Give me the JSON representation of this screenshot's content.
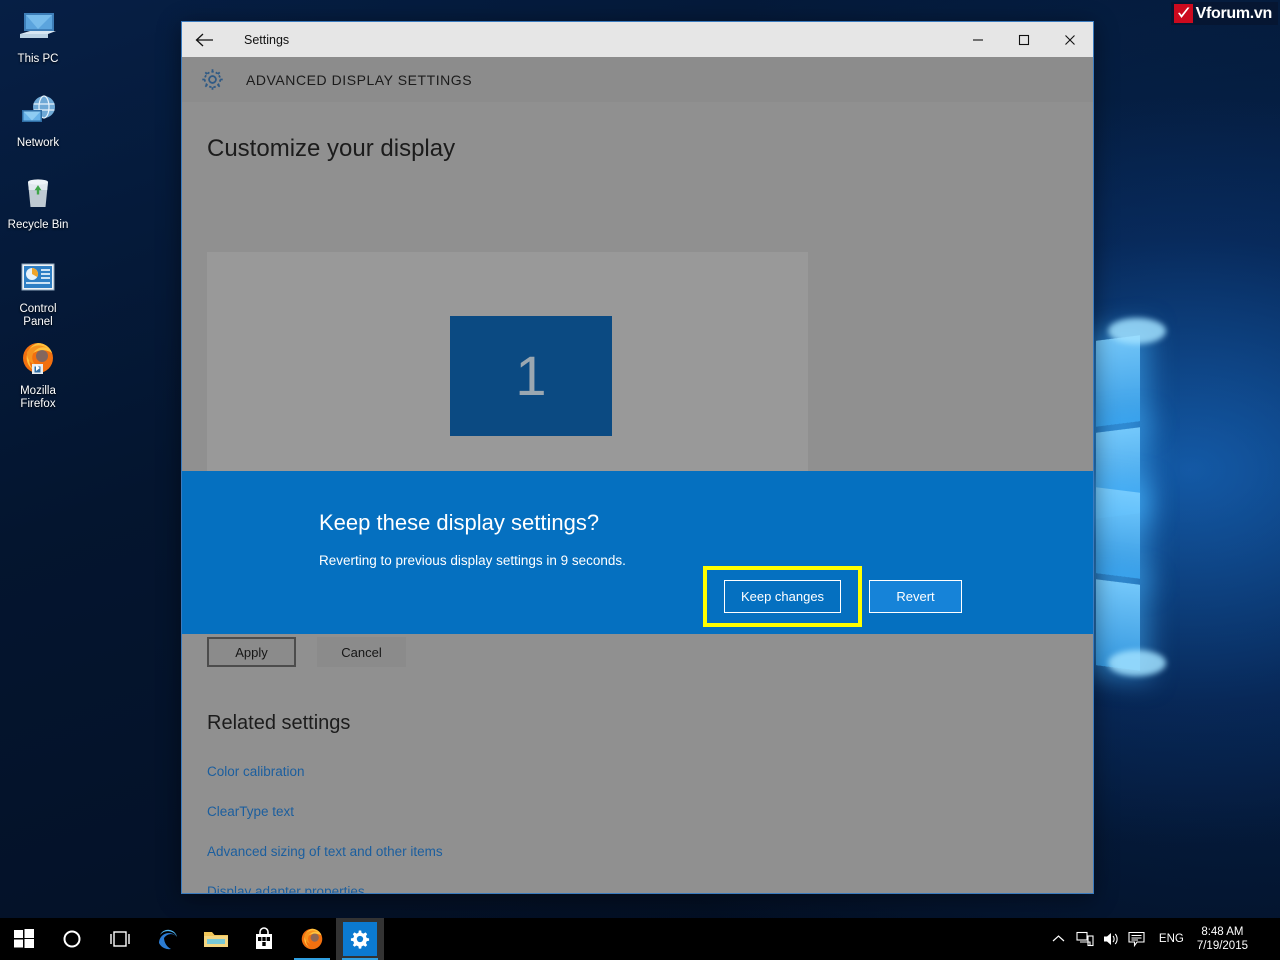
{
  "desktop": {
    "icons": [
      {
        "label": "This PC",
        "icon": "this-pc-icon"
      },
      {
        "label": "Network",
        "icon": "network-icon"
      },
      {
        "label": "Recycle Bin",
        "icon": "recycle-bin-icon"
      },
      {
        "label": "Control\nPanel",
        "label_line1": "Control",
        "label_line2": "Panel",
        "icon": "control-panel-icon"
      },
      {
        "label": "Mozilla\nFirefox",
        "label_line1": "Mozilla",
        "label_line2": "Firefox",
        "icon": "firefox-icon"
      }
    ]
  },
  "window": {
    "title": "Settings",
    "back_icon": "back-arrow-icon",
    "minimize_label": "─",
    "maximize_label": "□",
    "close_label": "✕",
    "app_header": {
      "icon": "gear-icon",
      "title": "ADVANCED DISPLAY SETTINGS"
    }
  },
  "main": {
    "page_heading": "Customize your display",
    "monitor_number": "1",
    "apply_label": "Apply",
    "cancel_label": "Cancel",
    "related_heading": "Related settings",
    "related_links": [
      "Color calibration",
      "ClearType text",
      "Advanced sizing of text and other items",
      "Display adapter properties"
    ]
  },
  "keep_dialog": {
    "title": "Keep these display settings?",
    "subtitle": "Reverting to previous display settings in  9 seconds.",
    "seconds_remaining": "9",
    "keep_label": "Keep changes",
    "revert_label": "Revert",
    "highlight_color": "#ffff00",
    "banner_color": "#0570c0"
  },
  "taskbar": {
    "items": [
      {
        "name": "start-button",
        "icon": "windows-logo-icon"
      },
      {
        "name": "cortana-search",
        "icon": "circle-icon"
      },
      {
        "name": "task-view",
        "icon": "task-view-icon"
      },
      {
        "name": "edge-browser",
        "icon": "edge-icon"
      },
      {
        "name": "file-explorer",
        "icon": "folder-icon"
      },
      {
        "name": "microsoft-store",
        "icon": "store-bag-icon"
      },
      {
        "name": "firefox",
        "icon": "firefox-icon"
      },
      {
        "name": "settings-app",
        "icon": "gear-icon"
      }
    ],
    "tray": {
      "show_hidden_icon": "chevron-up-icon",
      "network_icon": "network-icon",
      "volume_icon": "speaker-icon",
      "action_center_icon": "action-center-icon",
      "language": "ENG",
      "time": "8:48 AM",
      "date": "7/19/2015"
    }
  },
  "watermark": {
    "text": "Vforum.vn",
    "logo_icon": "checkmark-logo-icon"
  }
}
